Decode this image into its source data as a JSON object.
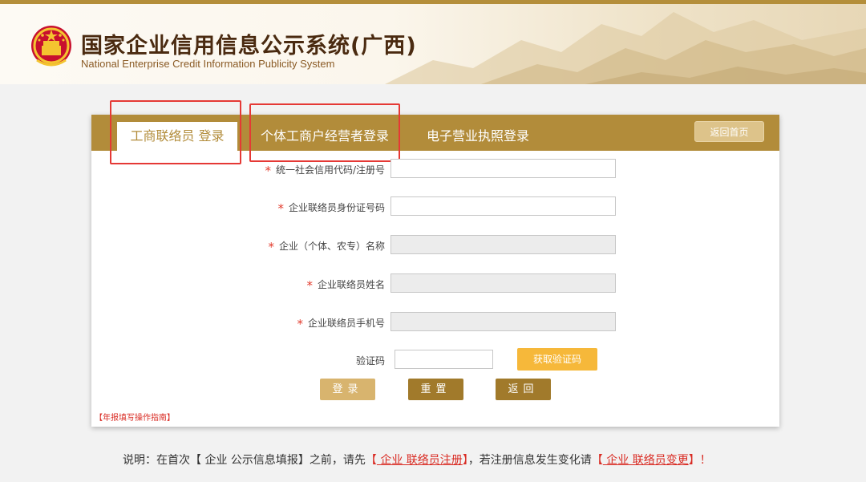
{
  "header": {
    "title_cn": "国家企业信用信息公示系统(广西)",
    "title_en": "National Enterprise Credit Information Publicity System",
    "emblem_icon": "national-emblem-icon"
  },
  "tabs": {
    "active": "工商联络员 登录",
    "individual": "个体工商户经营者登录",
    "e_license": "电子营业执照登录",
    "home_button": "返回首页"
  },
  "form": {
    "required_mark": "*",
    "code_label": "统一社会信用代码/注册号",
    "id_label": "企业联络员身份证号码",
    "name_label": "企业（个体、农专）名称",
    "contact_label": "企业联络员姓名",
    "phone_label": "企业联络员手机号",
    "captcha_label": "验证码",
    "get_code_button": "获取验证码",
    "login_button": "登录",
    "reset_button": "重置",
    "back_button": "返回",
    "guide_link": "【年报填写操作指南】"
  },
  "note": {
    "prefix": "说明：在首次【 企业 公示信息填报】之前，请先",
    "register_link_open": "【",
    "register_link": " 企业 联络员注册",
    "register_link_close": "】",
    "middle": "，若注册信息发生变化请",
    "change_open": "【",
    "change_link": " 企业 联络员变更",
    "change_close": "】！"
  },
  "colors": {
    "accent": "#b28c3a",
    "highlight_box": "#e53935",
    "required": "#e23c2e",
    "orange_button": "#f6b83a"
  }
}
